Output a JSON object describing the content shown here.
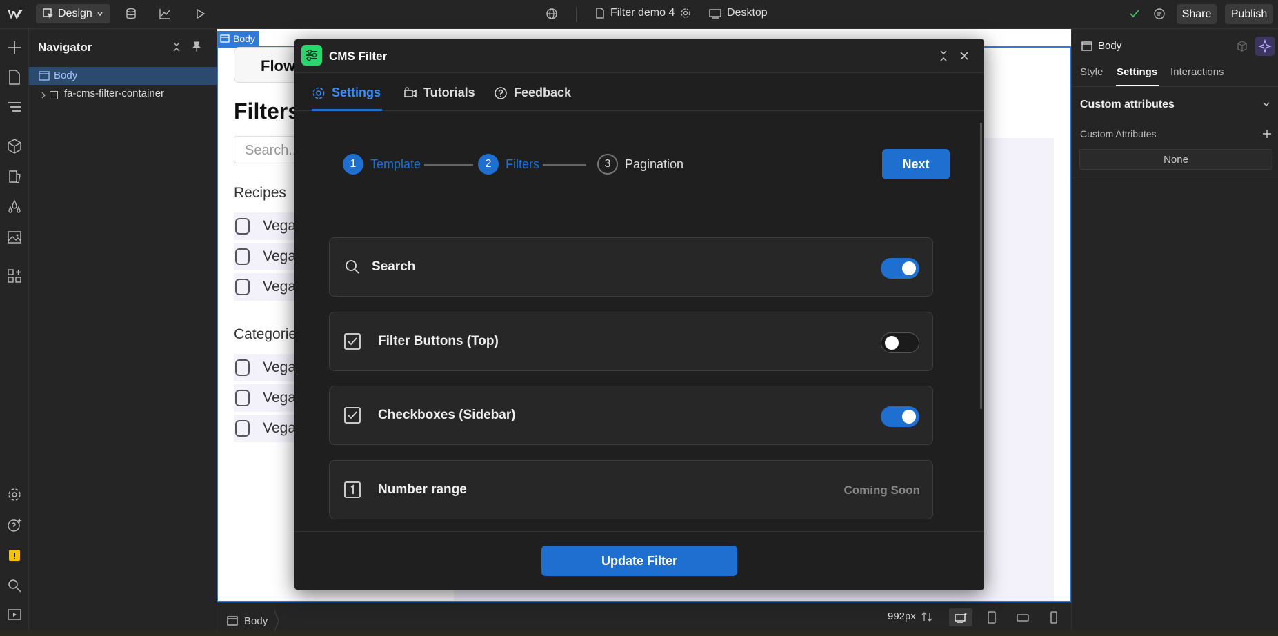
{
  "topbar": {
    "mode_label": "Design",
    "page_name": "Filter demo 4",
    "device_label": "Desktop",
    "share_label": "Share",
    "publish_label": "Publish"
  },
  "navigator": {
    "title": "Navigator",
    "root": "Body",
    "child": "fa-cms-filter-container"
  },
  "canvas": {
    "body_tag": "Body",
    "flow_button": "Flow",
    "heading": "Filters",
    "search_placeholder": "Search...",
    "recipes_label": "Recipes",
    "categories_label": "Categorie",
    "checkbox_text": "Vega",
    "recipe_items": [
      "Vega",
      "Vega",
      "Vega"
    ],
    "category_items": [
      "Vega",
      "Vega",
      "Vega"
    ]
  },
  "modal": {
    "title": "CMS Filter",
    "tabs": [
      {
        "label": "Settings",
        "icon": "gear-icon",
        "active": true
      },
      {
        "label": "Tutorials",
        "icon": "video-icon",
        "active": false
      },
      {
        "label": "Feedback",
        "icon": "help-circle-icon",
        "active": false
      }
    ],
    "steps": [
      {
        "number": "1",
        "label": "Template",
        "done": true
      },
      {
        "number": "2",
        "label": "Filters",
        "done": true
      },
      {
        "number": "3",
        "label": "Pagination",
        "done": false
      }
    ],
    "next_label": "Next",
    "options": [
      {
        "label": "Search",
        "icon": "search-icon",
        "state": "on"
      },
      {
        "label": "Filter Buttons (Top)",
        "icon": "checkbox-icon",
        "state": "off"
      },
      {
        "label": "Checkboxes (Sidebar)",
        "icon": "checkbox-icon",
        "state": "on"
      },
      {
        "label": "Number range",
        "icon": "number-one-icon",
        "status": "Coming Soon"
      }
    ],
    "update_label": "Update Filter"
  },
  "right_panel": {
    "element": "Body",
    "tabs": [
      "Style",
      "Settings",
      "Interactions"
    ],
    "active_tab": "Settings",
    "section_title": "Custom attributes",
    "sub_label": "Custom Attributes",
    "none_label": "None"
  },
  "bottombar": {
    "breadcrumb": "Body",
    "width_label": "992px"
  },
  "colors": {
    "accent": "#1f6fd1",
    "brand_green": "#2bd66f",
    "canvas_outline": "#2f7ad6"
  }
}
